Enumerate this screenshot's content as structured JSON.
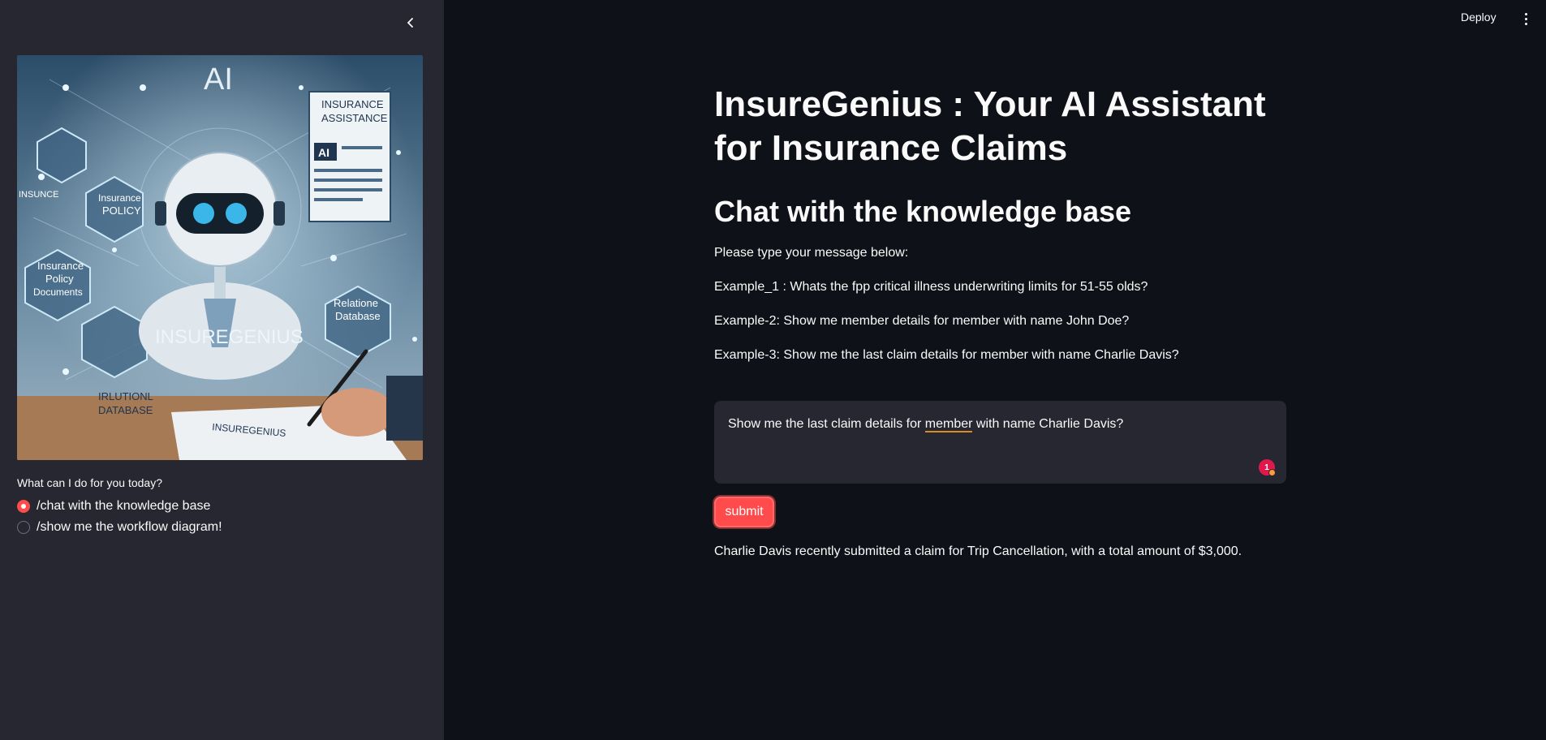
{
  "header": {
    "deploy_label": "Deploy"
  },
  "sidebar": {
    "radio_label": "What can I do for you today?",
    "options": [
      {
        "label": "/chat with the knowledge base",
        "selected": true
      },
      {
        "label": "/show me the workflow diagram!",
        "selected": false
      }
    ],
    "hero_text": {
      "ai": "AI",
      "doc_title_1": "INSURANCE",
      "doc_title_2": "ASSISTANCE",
      "doc_ai": "AI",
      "hex_policy_1": "Insurance",
      "hex_policy_2": "POLICY",
      "hex_docs_1": "Insurance",
      "hex_docs_2": "Policy",
      "hex_docs_3": "Documents",
      "hex_db_1": "Relatione",
      "hex_db_2": "Database",
      "brand": "INSUREGENIUS",
      "left_label": "INSUNCE",
      "bottom_1": "IRLUTIONL",
      "bottom_2": "DATABASE",
      "paper": "INSUREGENIUS"
    }
  },
  "main": {
    "title": "InsureGenius : Your AI Assistant for Insurance Claims",
    "subtitle": "Chat with the knowledge base",
    "prompt": "Please type your message below:",
    "examples": [
      "Example_1 : Whats the fpp critical illness underwriting limits for 51-55 olds?",
      "Example-2: Show me member details for member with name John Doe?",
      "Example-3: Show me the last claim details for member with name Charlie Davis?"
    ],
    "input": {
      "value_before": "Show me the last claim details for ",
      "value_flagged": "member",
      "value_after": " with name Charlie Davis?",
      "badge_count": "1"
    },
    "submit_label": "submit",
    "response": "Charlie Davis recently submitted a claim for Trip Cancellation, with a total amount of $3,000."
  },
  "colors": {
    "background": "#0e1117",
    "sidebar": "#262730",
    "accent": "#ff4b4b",
    "text": "#fafafa"
  }
}
